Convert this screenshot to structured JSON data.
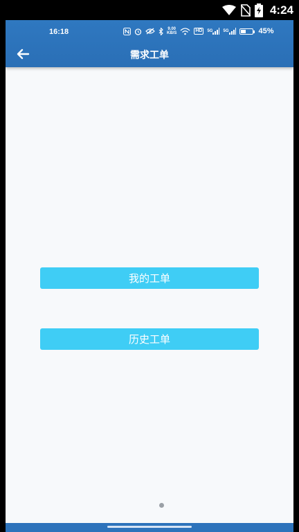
{
  "system_status": {
    "time": "4:24",
    "icons": [
      "wifi-icon",
      "no-sim-icon",
      "battery-charging-icon"
    ]
  },
  "app_status": {
    "time": "16:18",
    "net_speed_top": "9.00",
    "net_speed_bottom": "KB/S",
    "hd_label": "HD",
    "sim1_label": "5G",
    "sim2_label": "5G",
    "battery_percent": "45%",
    "battery_level": 0.45,
    "icons": [
      "nfc-icon",
      "alarm-icon",
      "eye-off-icon",
      "bluetooth-icon",
      "wifi-icon",
      "hd-icon",
      "signal-icon",
      "signal-icon",
      "battery-icon"
    ]
  },
  "header": {
    "title": "需求工单",
    "back_icon": "back-arrow-icon"
  },
  "buttons": {
    "mine": "我的工单",
    "history": "历史工单"
  },
  "colors": {
    "header": "#2a6fb6",
    "button": "#3fcdf5",
    "background": "#f7f9fb"
  }
}
